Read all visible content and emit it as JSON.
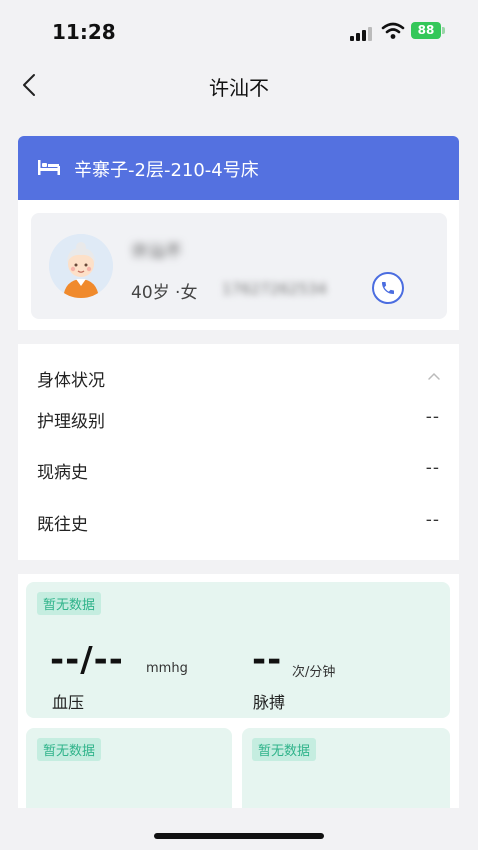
{
  "status_bar": {
    "time": "11:28",
    "battery": "88"
  },
  "nav": {
    "title": "许汕不"
  },
  "bed": {
    "label": "辛寨子-2层-210-4号床"
  },
  "patient": {
    "name": "许汕不",
    "age_gender": "40岁 ·女",
    "phone": "17627262534"
  },
  "health": {
    "title": "身体状况",
    "rows": [
      {
        "label": "护理级别",
        "value": "--"
      },
      {
        "label": "现病史",
        "value": "--"
      },
      {
        "label": "既往史",
        "value": "--"
      }
    ]
  },
  "vitals": {
    "blood_pressure": {
      "badge": "暂无数据",
      "value": "--/--",
      "unit": "mmhg",
      "label": "血压"
    },
    "pulse": {
      "value": "--",
      "unit": "次/分钟",
      "label": "脉搏"
    },
    "card2": {
      "badge": "暂无数据"
    },
    "card3": {
      "badge": "暂无数据"
    }
  },
  "colors": {
    "accent": "#5471e0",
    "vital_bg": "#e6f5f0",
    "badge_text": "#2fb38a"
  }
}
